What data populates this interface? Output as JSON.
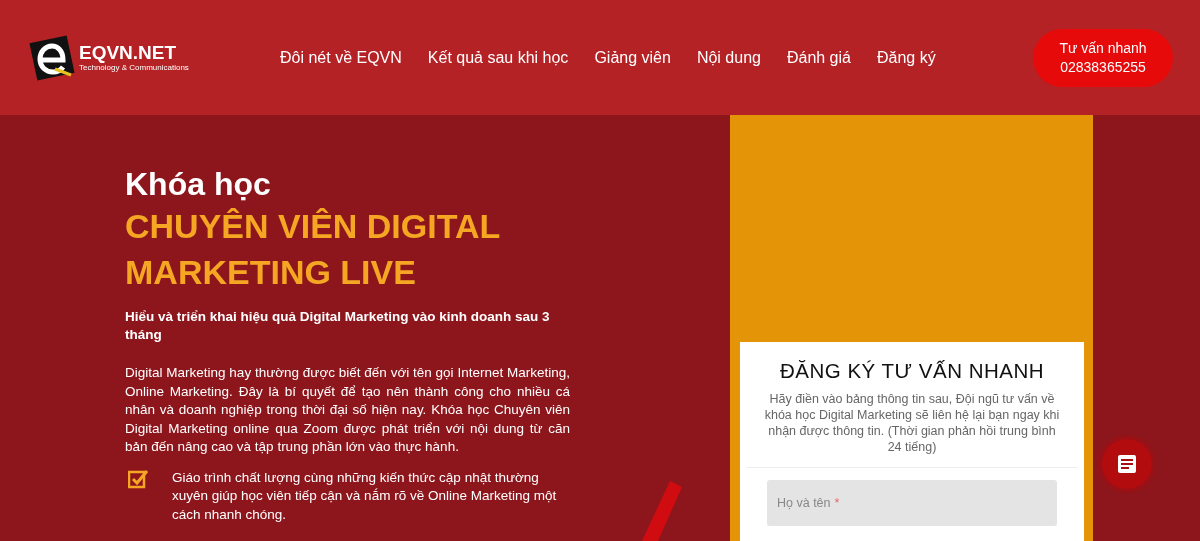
{
  "header": {
    "logo": {
      "name": "EQVN.NET",
      "tagline": "Technology & Communications"
    },
    "nav": [
      {
        "label": "Đôi nét về EQVN"
      },
      {
        "label": "Kết quả sau khi học"
      },
      {
        "label": "Giảng viên"
      },
      {
        "label": "Nội dung"
      },
      {
        "label": "Đánh giá"
      },
      {
        "label": "Đăng ký"
      }
    ],
    "cta": {
      "label": "Tư vấn nhanh",
      "phone": "02838365255"
    }
  },
  "hero": {
    "eyebrow": "Khóa học",
    "title_lines": [
      "CHUYÊN VIÊN DIGITAL",
      "MARKETING LIVE"
    ],
    "subtitle": "Hiểu và triển khai hiệu quả Digital Marketing vào kinh doanh sau 3 tháng",
    "description": "Digital Marketing hay thường được biết đến với tên gọi Internet Marketing, Online Marketing. Đây là bí quyết để tạo nên thành công cho nhiều cá nhân và doanh nghiệp trong thời đại số hiện nay. Khóa học Chuyên viên Digital Marketing online qua Zoom được phát triển với nội dung từ căn bản đến nâng cao và tập trung phần lớn vào thực hành.",
    "features": [
      {
        "text": "Giáo trình chất lượng cùng những kiến thức cập nhật thường xuyên giúp học viên tiếp cận và nắm rõ về Online Marketing một cách nhanh chóng.",
        "checked": true
      }
    ]
  },
  "form": {
    "title": "ĐĂNG KÝ TƯ VẤN NHANH",
    "intro": "Hãy điền vào bảng thông tin sau, Đội ngũ tư vấn về khóa học Digital Marketing sẽ liên hệ lại bạn ngay khi nhận được thông tin. (Thời gian phản hồi trung bình 24 tiếng)",
    "fields": [
      {
        "placeholder": "Họ và tên",
        "required_mark": "*"
      }
    ]
  }
}
